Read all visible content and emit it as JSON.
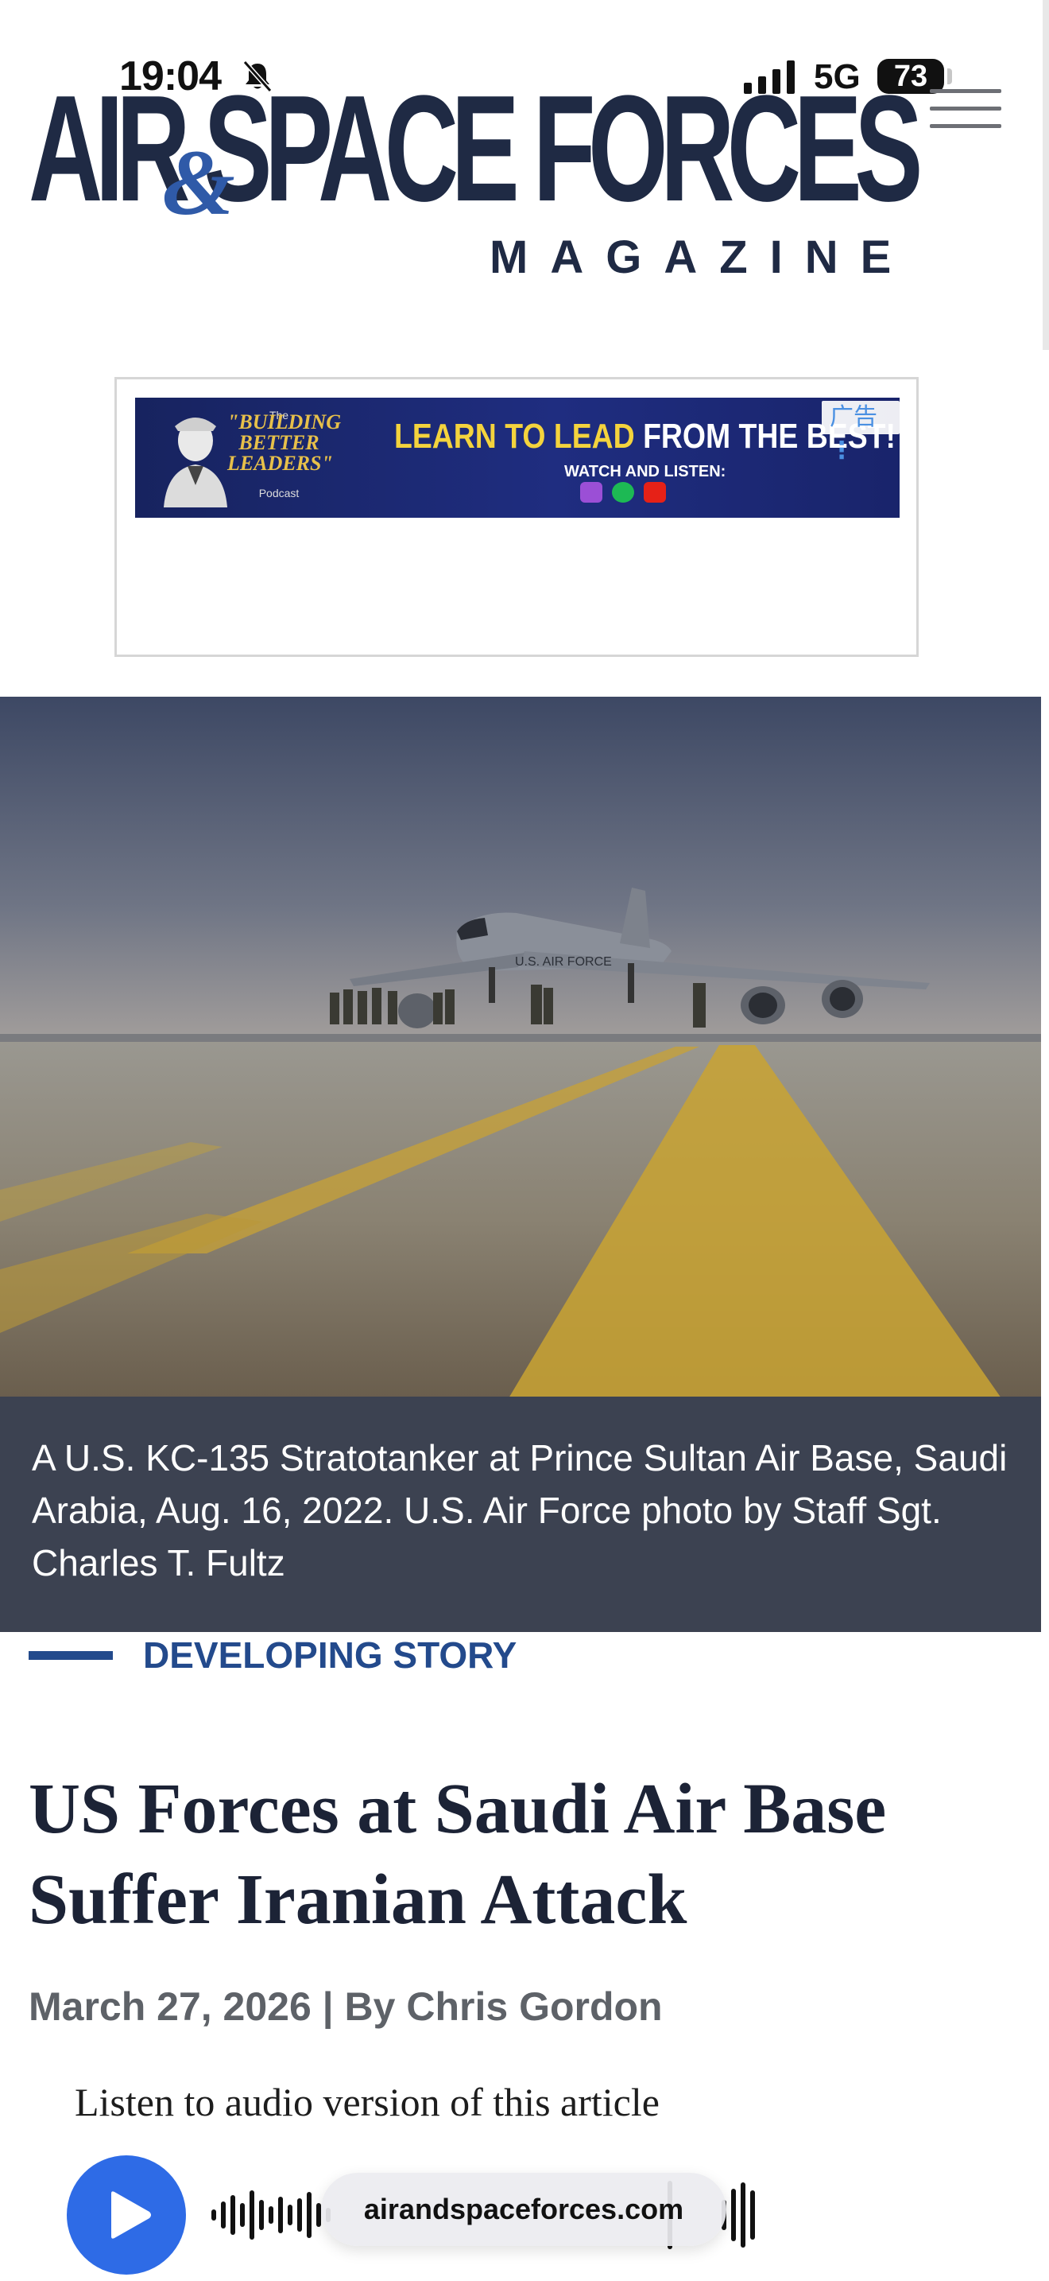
{
  "status_bar": {
    "time": "19:04",
    "network": "5G",
    "battery": "73"
  },
  "header": {
    "logo_main": "AIR SPACE FORCES",
    "logo_amp": "&",
    "logo_sub": "MAGAZINE"
  },
  "ad": {
    "badge": "广告",
    "podcast_small": "The",
    "podcast_title": "\"BUILDING BETTER LEADERS\"",
    "podcast_tag": "Podcast",
    "headline_yellow": "LEARN TO LEAD ",
    "headline_white": "FROM THE BEST!",
    "watch": "WATCH AND LISTEN:"
  },
  "hero": {
    "caption": "A U.S. KC-135 Stratotanker at Prince Sultan Air Base, Saudi Arabia, Aug. 16, 2022. U.S. Air Force photo by Staff Sgt. Charles T. Fultz",
    "tail_marking": "U.S. AIR FORCE"
  },
  "article": {
    "kicker": "DEVELOPING STORY",
    "headline": "US Forces at Saudi Air Base Suffer Iranian Attack",
    "byline": "March 27, 2026 | By Chris Gordon",
    "listen_label": "Listen to audio version of this article"
  },
  "browser": {
    "url": "airandspaceforces.com"
  },
  "colors": {
    "brand_navy": "#1f2a44",
    "brand_blue": "#234a8c",
    "play_blue": "#2e6be6"
  },
  "icons": [
    "bell-slash-icon",
    "signal-icon",
    "menu-icon",
    "play-icon"
  ]
}
